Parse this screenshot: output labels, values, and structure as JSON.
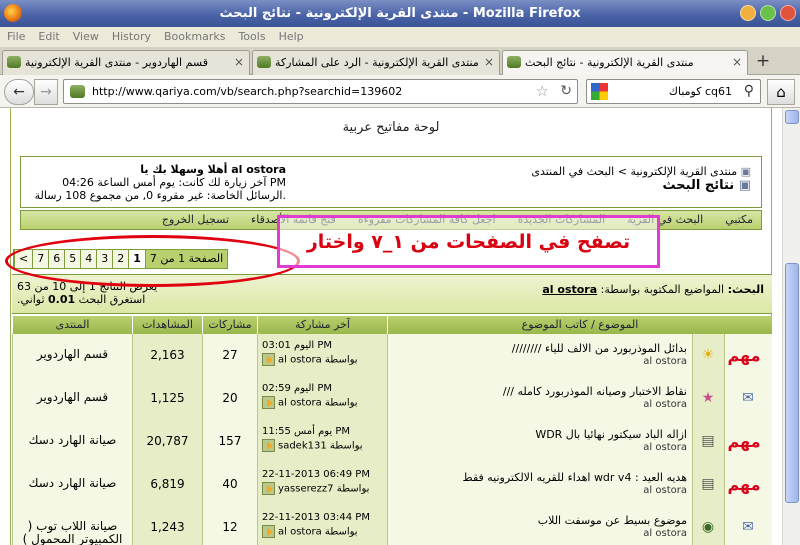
{
  "window": {
    "title": "منتدى القرية الإلكترونية - نتائج البحث - Mozilla Firefox"
  },
  "menu": [
    "File",
    "Edit",
    "View",
    "History",
    "Bookmarks",
    "Tools",
    "Help"
  ],
  "tabs": [
    {
      "label": "قسم الهاردوير - منتدى القرية الإلكترونية"
    },
    {
      "label": "منتدى القرية الإلكترونية - الرد على المشاركة"
    },
    {
      "label": "منتدى القرية الإلكترونية - نتائج البحث"
    }
  ],
  "nav": {
    "url": "http://www.qariya.com/vb/search.php?searchid=139602",
    "search": "كومباك cq61"
  },
  "page": {
    "kb_title": "لوحة مفاتيح عربية",
    "breadcrumb": "منتدى القرية الإلكترونية > البحث في المنتدى",
    "page_title": "نتائج البحث",
    "welcome": "أهلا وسهلا بك يا al ostora",
    "last_visit": "آخر زيارة لك كانت: يوم أمس الساعة 04:26 PM",
    "pm": "الرسائل الخاصة: غير مقروء 0, من مجموع 108 رسالة.",
    "nav_links": [
      "مكتبي",
      "البحث في القرية",
      "المشاركات الجديدة",
      "اجعل كافة المشاركات مقروءة",
      "فتح قائمة الأصدقاء",
      "تسجيل الخروج"
    ],
    "pager": {
      "label": "الصفحة 1 من 7",
      "pages": [
        "1",
        "2",
        "3",
        "4",
        "5",
        "6",
        "7",
        ">"
      ],
      "current": "1"
    },
    "annotation": "تصفح في الصفحات من ١_٧ واختار",
    "results_label": "البحث:",
    "results_desc": "المواضيع المكتوبة بواسطة:",
    "results_user": "al ostora",
    "results_count": "يعرض النتائج 1 إلى 10 من 63",
    "search_time_label": "استغرق البحث",
    "search_time_value": "0.01",
    "search_time_unit": "ثواني.",
    "headers": {
      "topic": "الموضوع / كاتب الموضوع",
      "last": "آخر مشاركة",
      "replies": "مشاركات",
      "views": "المشاهدات",
      "forum": "المنتدى"
    },
    "rows": [
      {
        "tag": "مهم",
        "icon": "sun-icon",
        "title": "بدائل الموذربورد من الالف للياء ////////",
        "author": "al ostora",
        "last_time": "اليوم 03:01 PM",
        "last_by": "al ostora",
        "replies": "27",
        "views": "2,163",
        "forum": "قسم الهاردوير"
      },
      {
        "tag": "",
        "icon": "star-icon",
        "title": "نقاط الاختبار وصيانه الموذربورد كامله ///",
        "author": "al ostora",
        "last_time": "اليوم 02:59 PM",
        "last_by": "al ostora",
        "replies": "20",
        "views": "1,125",
        "forum": "قسم الهاردوير"
      },
      {
        "tag": "مهم",
        "icon": "document-icon",
        "title": "ازاله الباد سيكتور نهائيا بال WDR",
        "author": "al ostora",
        "last_time": "يوم أمس 11:55 PM",
        "last_by": "sadek131",
        "replies": "157",
        "views": "20,787",
        "forum": "صيانة الهارد دسك"
      },
      {
        "tag": "مهم",
        "icon": "document-icon",
        "title": "هديه العيد : wdr v4 اهداء للقريه الالكترونيه فقط",
        "author": "al ostora",
        "last_time": "22-11-2013 06:49 PM",
        "last_by": "yasserezz7",
        "replies": "40",
        "views": "6,819",
        "forum": "صيانة الهارد دسك"
      },
      {
        "tag": "",
        "icon": "eye-icon",
        "title": "موضوع بسيط عن موسفت اللاب",
        "author": "al ostora",
        "last_time": "22-11-2013 03:44 PM",
        "last_by": "al ostora",
        "replies": "12",
        "views": "1,243",
        "forum": "صيانة اللاب توب ( الكمبيوتر المحمول )"
      }
    ],
    "by": "بواسطة"
  }
}
